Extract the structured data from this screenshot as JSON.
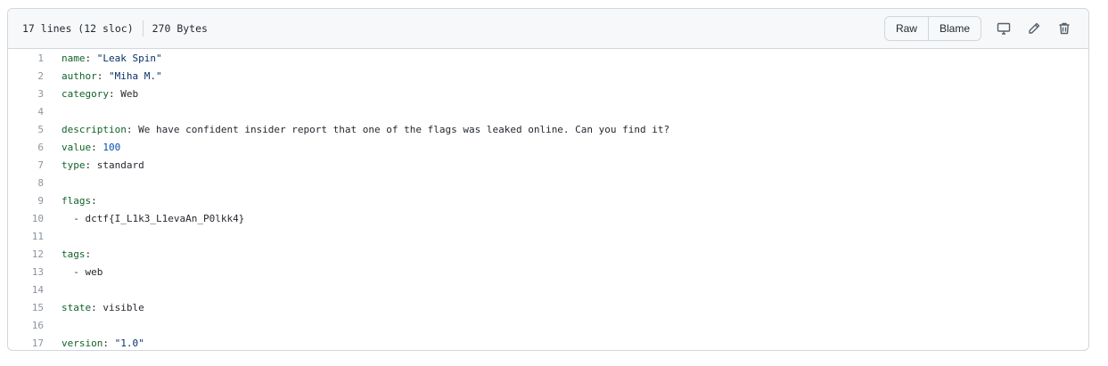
{
  "file_header": {
    "lines_info": "17 lines (12 sloc)",
    "size": "270 Bytes",
    "raw_label": "Raw",
    "blame_label": "Blame"
  },
  "colors": {
    "key": "#116329",
    "string": "#0a3069",
    "number": "#0550ae",
    "line_number": "#8c959f",
    "text": "#24292f"
  },
  "code_lines": [
    {
      "num": "1",
      "indent": "",
      "key": "name",
      "sep": ": ",
      "value": "\"Leak Spin\"",
      "vtype": "str"
    },
    {
      "num": "2",
      "indent": "",
      "key": "author",
      "sep": ": ",
      "value": "\"Miha M.\"",
      "vtype": "str"
    },
    {
      "num": "3",
      "indent": "",
      "key": "category",
      "sep": ": ",
      "value": "Web",
      "vtype": "plain"
    },
    {
      "num": "4",
      "indent": "",
      "key": "",
      "sep": "",
      "value": "",
      "vtype": "plain"
    },
    {
      "num": "5",
      "indent": "",
      "key": "description",
      "sep": ": ",
      "value": "We have confident insider report that one of the flags was leaked online. Can you find it?",
      "vtype": "plain"
    },
    {
      "num": "6",
      "indent": "",
      "key": "value",
      "sep": ": ",
      "value": "100",
      "vtype": "num"
    },
    {
      "num": "7",
      "indent": "",
      "key": "type",
      "sep": ": ",
      "value": "standard",
      "vtype": "plain"
    },
    {
      "num": "8",
      "indent": "",
      "key": "",
      "sep": "",
      "value": "",
      "vtype": "plain"
    },
    {
      "num": "9",
      "indent": "",
      "key": "flags",
      "sep": ":",
      "value": "",
      "vtype": "plain"
    },
    {
      "num": "10",
      "indent": "  - ",
      "key": "",
      "sep": "",
      "value": "dctf{I_L1k3_L1evaAn_P0lkk4}",
      "vtype": "plain"
    },
    {
      "num": "11",
      "indent": "",
      "key": "",
      "sep": "",
      "value": "",
      "vtype": "plain"
    },
    {
      "num": "12",
      "indent": "",
      "key": "tags",
      "sep": ":",
      "value": "",
      "vtype": "plain"
    },
    {
      "num": "13",
      "indent": "  - ",
      "key": "",
      "sep": "",
      "value": "web",
      "vtype": "plain"
    },
    {
      "num": "14",
      "indent": "",
      "key": "",
      "sep": "",
      "value": "",
      "vtype": "plain"
    },
    {
      "num": "15",
      "indent": "",
      "key": "state",
      "sep": ": ",
      "value": "visible",
      "vtype": "plain"
    },
    {
      "num": "16",
      "indent": "",
      "key": "",
      "sep": "",
      "value": "",
      "vtype": "plain"
    },
    {
      "num": "17",
      "indent": "",
      "key": "version",
      "sep": ": ",
      "value": "\"1.0\"",
      "vtype": "str"
    }
  ],
  "icons": {
    "display": "desktop-icon",
    "edit": "pencil-icon",
    "delete": "trash-icon"
  }
}
